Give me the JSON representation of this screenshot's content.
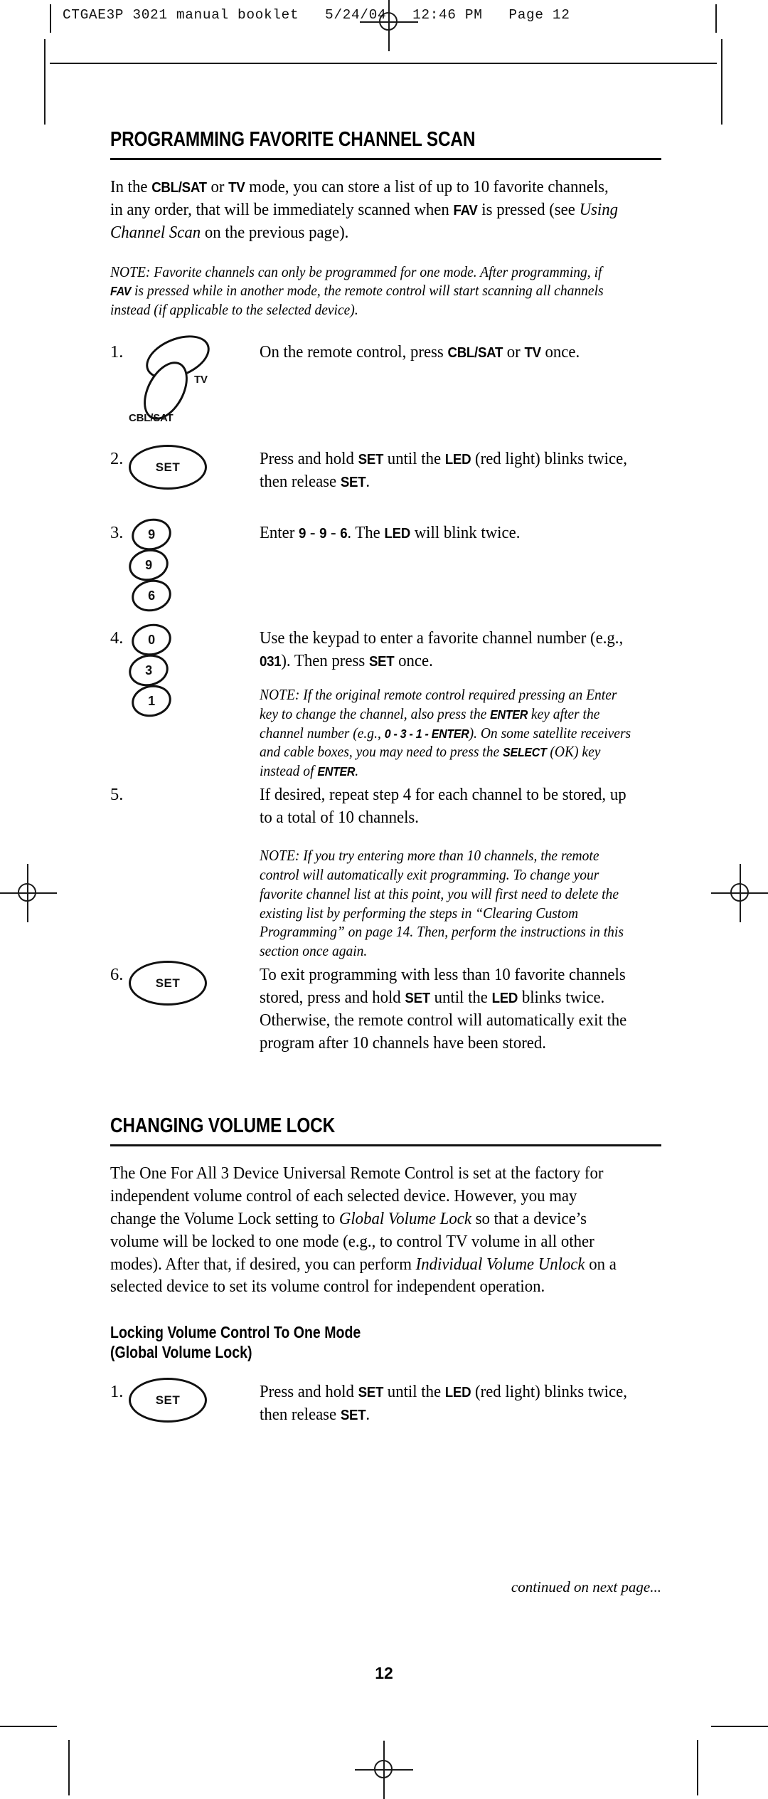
{
  "imprint": {
    "text": "CTGAE3P 3021 manual booklet   5/24/04   12:46 PM   Page 12"
  },
  "sections": [
    {
      "title": "PROGRAMMING FAVORITE CHANNEL SCAN",
      "intro_1": "In the ",
      "intro_kb1": "CBL/SAT",
      "intro_2": " or ",
      "intro_kb2": "TV",
      "intro_3": " mode, you can store a list of up to 10 favorite channels, in any order, that will be immediately scanned when ",
      "intro_kb3": "FAV",
      "intro_4": " is pressed (see ",
      "intro_em": "Using Channel Scan",
      "intro_5": " on the previous page).",
      "note_1": "NOTE: Favorite channels can only be programmed for one mode. After programming, if ",
      "note_kb": "FAV",
      "note_2": " is pressed while in another mode, the remote control will start scanning all channels instead (if applicable to the selected device)."
    },
    {
      "title": "CHANGING VOLUME LOCK",
      "para_1": "The One For All 3 Device Universal Remote Control is set at the factory for independent volume control of each selected device. However, you may change the Volume Lock setting to ",
      "para_em1": "Global Volume Lock",
      "para_2": " so that a device’s volume will be locked to one mode (e.g., to control TV volume in all other modes). After that, if desired, you can perform ",
      "para_em2": "Individual Volume Unlock",
      "para_3": " on a selected device to set its volume control for independent operation.",
      "sub_title_line1": "Locking Volume Control To One Mode",
      "sub_title_line2": "(Global Volume Lock)"
    }
  ],
  "steps": [
    {
      "num": "1.",
      "art": "mode-buttons",
      "label_tv": "TV",
      "label_cbl": "CBL/SAT",
      "text_1": "On the remote control, press ",
      "kb_1": "CBL/SAT",
      "text_2": " or ",
      "kb_2": "TV",
      "text_3": " once."
    },
    {
      "num": "2.",
      "art": "set-button",
      "button_label": "SET",
      "text_1": "Press and hold ",
      "kb_1": "SET",
      "text_2": " until the ",
      "kb_2": "LED",
      "text_3": " (red light) blinks twice, then release ",
      "kb_3": "SET",
      "text_4": "."
    },
    {
      "num": "3.",
      "art": "digit-keys",
      "digits": [
        "9",
        "9",
        "6"
      ],
      "text_1": "Enter ",
      "kb_1": "9",
      "text_2": " - ",
      "kb_2": "9",
      "text_3": " - ",
      "kb_3": "6",
      "text_4": ". The ",
      "kb_4": "LED",
      "text_5": " will blink twice."
    },
    {
      "num": "4.",
      "art": "digit-keys",
      "digits": [
        "0",
        "3",
        "1"
      ],
      "text_1": "Use the keypad to enter a favorite channel number (e.g., ",
      "kb_1": "031",
      "text_2": "). Then press ",
      "kb_2": "SET",
      "text_3": " once.",
      "note_1": "NOTE: If the original remote control required pressing an Enter key to change the channel, also press the ",
      "note_kb1": "ENTER",
      "note_2": " key after the channel number (e.g., ",
      "note_kb2": "0 - 3 - 1 - ENTER",
      "note_3": "). On some satellite receivers and cable boxes, you may need to press the ",
      "note_kb3": "SELECT",
      "note_4": " (OK) key instead of ",
      "note_kb4": "ENTER",
      "note_5": "."
    },
    {
      "num": "5.",
      "art": "none",
      "text_1": "If desired, repeat step 4 for each channel to be stored, up to a total of 10 channels.",
      "note_1": "NOTE: If you try entering more than 10 channels, the remote control will automatically exit programming. To change your favorite channel list at this point, you will first need to delete the existing list by performing the steps in “Clearing Custom Programming” on page 14. Then, perform the instructions in this section once again."
    },
    {
      "num": "6.",
      "art": "set-button",
      "button_label": "SET",
      "text_1": "To exit programming with less than 10 favorite channels stored, press and hold ",
      "kb_1": "SET",
      "text_2": " until the ",
      "kb_2": "LED",
      "text_3": " blinks twice. Otherwise, the remote control will automatically exit the program after 10 channels have been stored."
    }
  ],
  "volume_step": {
    "num": "1.",
    "button_label": "SET",
    "text_1": "Press and hold ",
    "kb_1": "SET",
    "text_2": " until the ",
    "kb_2": "LED",
    "text_3": " (red light) blinks twice, then release ",
    "kb_3": "SET",
    "text_4": "."
  },
  "footer": {
    "continued": "continued on next page...",
    "page_number": "12"
  }
}
